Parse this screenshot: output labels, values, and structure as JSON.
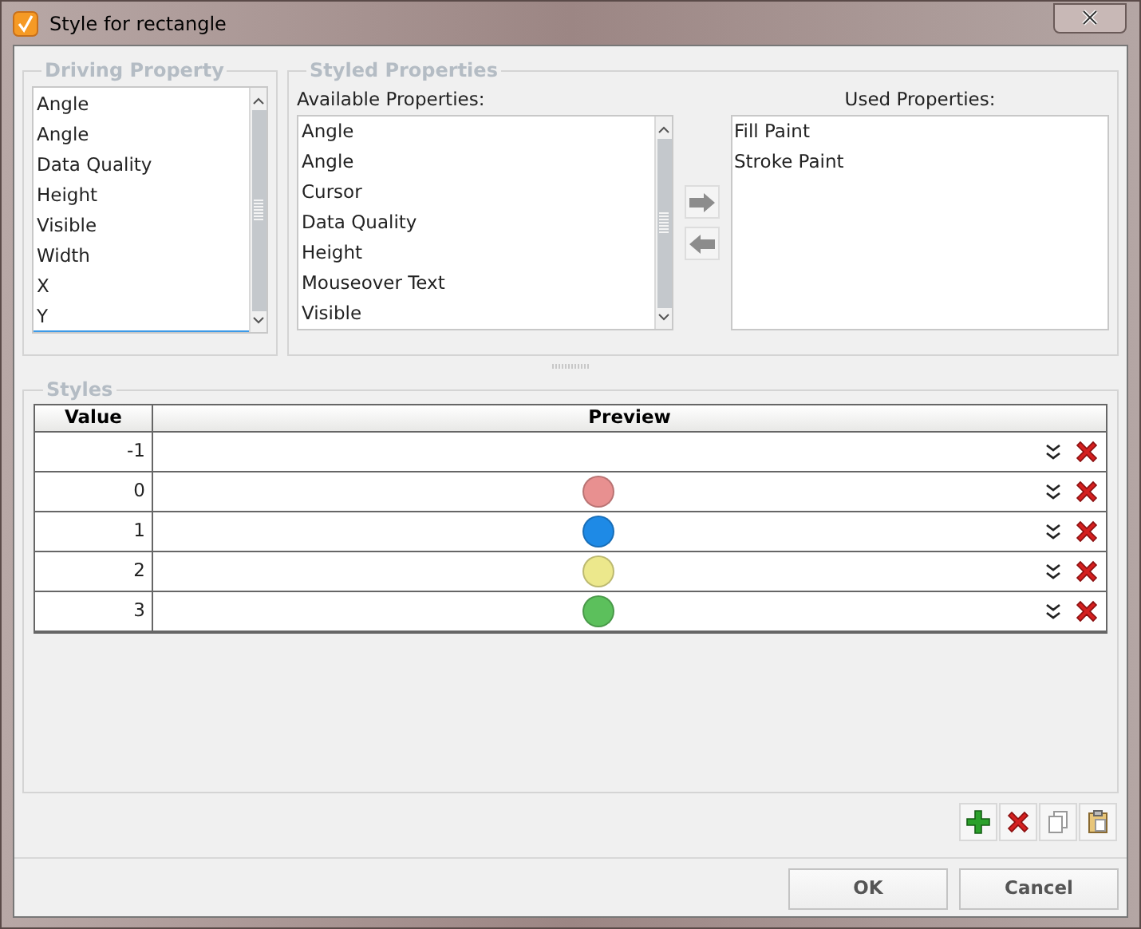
{
  "window": {
    "title": "Style for rectangle"
  },
  "driving_property": {
    "legend": "Driving Property",
    "items": [
      {
        "label": "Angle",
        "focused": false
      },
      {
        "label": "Angle",
        "focused": false
      },
      {
        "label": "Data Quality",
        "focused": false
      },
      {
        "label": "Height",
        "focused": false
      },
      {
        "label": "Visible",
        "focused": false
      },
      {
        "label": "Width",
        "focused": false
      },
      {
        "label": "X",
        "focused": false
      },
      {
        "label": "Y",
        "focused": true
      }
    ]
  },
  "styled_properties": {
    "legend": "Styled Properties",
    "available_label": "Available Properties:",
    "available": [
      "Angle",
      "Angle",
      "Cursor",
      "Data Quality",
      "Height",
      "Mouseover Text",
      "Visible"
    ],
    "used_label": "Used Properties:",
    "used": [
      "Fill Paint",
      "Stroke Paint"
    ]
  },
  "styles": {
    "legend": "Styles",
    "columns": [
      "Value",
      "Preview"
    ],
    "rows": [
      {
        "value": "-1"
      },
      {
        "value": "0",
        "color": "#e89090"
      },
      {
        "value": "1",
        "color": "#1e8ae6"
      },
      {
        "value": "2",
        "color": "#ece88c"
      },
      {
        "value": "3",
        "color": "#5cc05c"
      }
    ]
  },
  "buttons": [
    "OK",
    "Cancel"
  ]
}
